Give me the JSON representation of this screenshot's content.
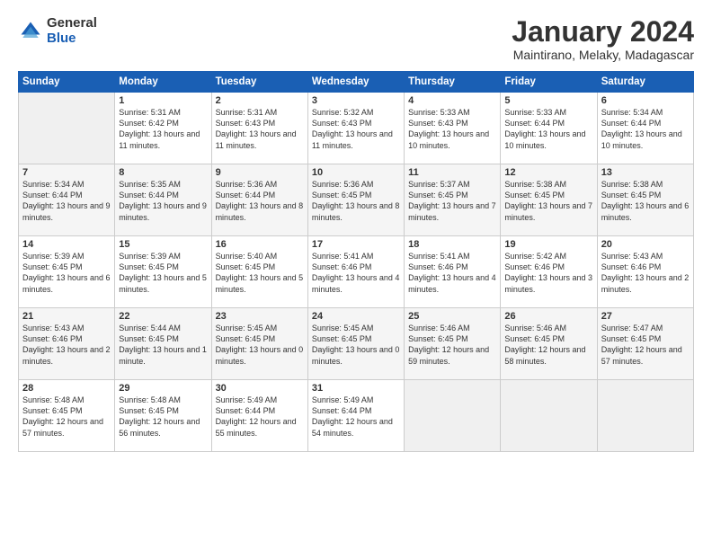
{
  "logo": {
    "general": "General",
    "blue": "Blue"
  },
  "title": "January 2024",
  "subtitle": "Maintirano, Melaky, Madagascar",
  "days": [
    "Sunday",
    "Monday",
    "Tuesday",
    "Wednesday",
    "Thursday",
    "Friday",
    "Saturday"
  ],
  "weeks": [
    [
      {
        "num": "",
        "sunrise": "",
        "sunset": "",
        "daylight": ""
      },
      {
        "num": "1",
        "sunrise": "Sunrise: 5:31 AM",
        "sunset": "Sunset: 6:42 PM",
        "daylight": "Daylight: 13 hours and 11 minutes."
      },
      {
        "num": "2",
        "sunrise": "Sunrise: 5:31 AM",
        "sunset": "Sunset: 6:43 PM",
        "daylight": "Daylight: 13 hours and 11 minutes."
      },
      {
        "num": "3",
        "sunrise": "Sunrise: 5:32 AM",
        "sunset": "Sunset: 6:43 PM",
        "daylight": "Daylight: 13 hours and 11 minutes."
      },
      {
        "num": "4",
        "sunrise": "Sunrise: 5:33 AM",
        "sunset": "Sunset: 6:43 PM",
        "daylight": "Daylight: 13 hours and 10 minutes."
      },
      {
        "num": "5",
        "sunrise": "Sunrise: 5:33 AM",
        "sunset": "Sunset: 6:44 PM",
        "daylight": "Daylight: 13 hours and 10 minutes."
      },
      {
        "num": "6",
        "sunrise": "Sunrise: 5:34 AM",
        "sunset": "Sunset: 6:44 PM",
        "daylight": "Daylight: 13 hours and 10 minutes."
      }
    ],
    [
      {
        "num": "7",
        "sunrise": "Sunrise: 5:34 AM",
        "sunset": "Sunset: 6:44 PM",
        "daylight": "Daylight: 13 hours and 9 minutes."
      },
      {
        "num": "8",
        "sunrise": "Sunrise: 5:35 AM",
        "sunset": "Sunset: 6:44 PM",
        "daylight": "Daylight: 13 hours and 9 minutes."
      },
      {
        "num": "9",
        "sunrise": "Sunrise: 5:36 AM",
        "sunset": "Sunset: 6:44 PM",
        "daylight": "Daylight: 13 hours and 8 minutes."
      },
      {
        "num": "10",
        "sunrise": "Sunrise: 5:36 AM",
        "sunset": "Sunset: 6:45 PM",
        "daylight": "Daylight: 13 hours and 8 minutes."
      },
      {
        "num": "11",
        "sunrise": "Sunrise: 5:37 AM",
        "sunset": "Sunset: 6:45 PM",
        "daylight": "Daylight: 13 hours and 7 minutes."
      },
      {
        "num": "12",
        "sunrise": "Sunrise: 5:38 AM",
        "sunset": "Sunset: 6:45 PM",
        "daylight": "Daylight: 13 hours and 7 minutes."
      },
      {
        "num": "13",
        "sunrise": "Sunrise: 5:38 AM",
        "sunset": "Sunset: 6:45 PM",
        "daylight": "Daylight: 13 hours and 6 minutes."
      }
    ],
    [
      {
        "num": "14",
        "sunrise": "Sunrise: 5:39 AM",
        "sunset": "Sunset: 6:45 PM",
        "daylight": "Daylight: 13 hours and 6 minutes."
      },
      {
        "num": "15",
        "sunrise": "Sunrise: 5:39 AM",
        "sunset": "Sunset: 6:45 PM",
        "daylight": "Daylight: 13 hours and 5 minutes."
      },
      {
        "num": "16",
        "sunrise": "Sunrise: 5:40 AM",
        "sunset": "Sunset: 6:45 PM",
        "daylight": "Daylight: 13 hours and 5 minutes."
      },
      {
        "num": "17",
        "sunrise": "Sunrise: 5:41 AM",
        "sunset": "Sunset: 6:46 PM",
        "daylight": "Daylight: 13 hours and 4 minutes."
      },
      {
        "num": "18",
        "sunrise": "Sunrise: 5:41 AM",
        "sunset": "Sunset: 6:46 PM",
        "daylight": "Daylight: 13 hours and 4 minutes."
      },
      {
        "num": "19",
        "sunrise": "Sunrise: 5:42 AM",
        "sunset": "Sunset: 6:46 PM",
        "daylight": "Daylight: 13 hours and 3 minutes."
      },
      {
        "num": "20",
        "sunrise": "Sunrise: 5:43 AM",
        "sunset": "Sunset: 6:46 PM",
        "daylight": "Daylight: 13 hours and 2 minutes."
      }
    ],
    [
      {
        "num": "21",
        "sunrise": "Sunrise: 5:43 AM",
        "sunset": "Sunset: 6:46 PM",
        "daylight": "Daylight: 13 hours and 2 minutes."
      },
      {
        "num": "22",
        "sunrise": "Sunrise: 5:44 AM",
        "sunset": "Sunset: 6:45 PM",
        "daylight": "Daylight: 13 hours and 1 minute."
      },
      {
        "num": "23",
        "sunrise": "Sunrise: 5:45 AM",
        "sunset": "Sunset: 6:45 PM",
        "daylight": "Daylight: 13 hours and 0 minutes."
      },
      {
        "num": "24",
        "sunrise": "Sunrise: 5:45 AM",
        "sunset": "Sunset: 6:45 PM",
        "daylight": "Daylight: 13 hours and 0 minutes."
      },
      {
        "num": "25",
        "sunrise": "Sunrise: 5:46 AM",
        "sunset": "Sunset: 6:45 PM",
        "daylight": "Daylight: 12 hours and 59 minutes."
      },
      {
        "num": "26",
        "sunrise": "Sunrise: 5:46 AM",
        "sunset": "Sunset: 6:45 PM",
        "daylight": "Daylight: 12 hours and 58 minutes."
      },
      {
        "num": "27",
        "sunrise": "Sunrise: 5:47 AM",
        "sunset": "Sunset: 6:45 PM",
        "daylight": "Daylight: 12 hours and 57 minutes."
      }
    ],
    [
      {
        "num": "28",
        "sunrise": "Sunrise: 5:48 AM",
        "sunset": "Sunset: 6:45 PM",
        "daylight": "Daylight: 12 hours and 57 minutes."
      },
      {
        "num": "29",
        "sunrise": "Sunrise: 5:48 AM",
        "sunset": "Sunset: 6:45 PM",
        "daylight": "Daylight: 12 hours and 56 minutes."
      },
      {
        "num": "30",
        "sunrise": "Sunrise: 5:49 AM",
        "sunset": "Sunset: 6:44 PM",
        "daylight": "Daylight: 12 hours and 55 minutes."
      },
      {
        "num": "31",
        "sunrise": "Sunrise: 5:49 AM",
        "sunset": "Sunset: 6:44 PM",
        "daylight": "Daylight: 12 hours and 54 minutes."
      },
      {
        "num": "",
        "sunrise": "",
        "sunset": "",
        "daylight": ""
      },
      {
        "num": "",
        "sunrise": "",
        "sunset": "",
        "daylight": ""
      },
      {
        "num": "",
        "sunrise": "",
        "sunset": "",
        "daylight": ""
      }
    ]
  ]
}
